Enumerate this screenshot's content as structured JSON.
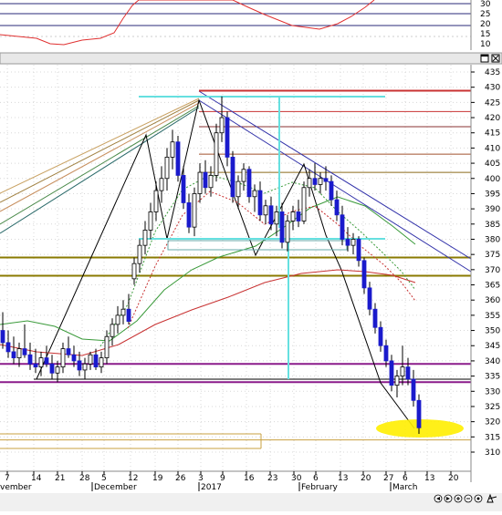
{
  "colors": {
    "bull_candle": "#ffffff",
    "bear_candle": "#1a1acc",
    "oscillator": "#e03030",
    "highlight": "#ffee00",
    "ma_red": "#c83232",
    "ma_green": "#3a9a3a",
    "trend_blue": "#3333aa",
    "cyan_marker": "#66e0e0",
    "support_purple": "#8a1b8a"
  },
  "top_panel": {
    "y_ticks": [
      "30",
      "25",
      "20",
      "15",
      "10"
    ]
  },
  "window_controls": {
    "maximize_icon": "maximize-icon",
    "close_icon": "close-icon"
  },
  "price_axis": {
    "ticks": [
      "435",
      "430",
      "425",
      "420",
      "415",
      "410",
      "405",
      "400",
      "395",
      "390",
      "385",
      "380",
      "375",
      "370",
      "365",
      "360",
      "355",
      "350",
      "345",
      "340",
      "335",
      "330",
      "325",
      "320",
      "315",
      "310"
    ]
  },
  "date_axis": {
    "day_ticks": [
      "7",
      "14",
      "21",
      "28",
      "5",
      "12",
      "19",
      "26",
      "3",
      "9",
      "16",
      "23",
      "30",
      "6",
      "13",
      "20",
      "27",
      "6",
      "13",
      "20"
    ],
    "month_labels": [
      "vember",
      "December",
      "2017",
      "February",
      "March"
    ]
  },
  "navigation": {
    "icons": [
      "scroll-left-icon",
      "scroll-right-icon",
      "zoom-in-icon",
      "zoom-out-icon",
      "reset-icon",
      "settings-icon"
    ]
  },
  "chart_data": {
    "type": "candlestick",
    "xlabel": "",
    "ylabel": "",
    "ylim": [
      307,
      437
    ],
    "candles": [
      {
        "x": 0,
        "o": 350,
        "h": 356,
        "l": 344,
        "c": 346
      },
      {
        "x": 1,
        "o": 346,
        "h": 350,
        "l": 341,
        "c": 343
      },
      {
        "x": 2,
        "o": 343,
        "h": 348,
        "l": 339,
        "c": 341
      },
      {
        "x": 3,
        "o": 341,
        "h": 346,
        "l": 338,
        "c": 344
      },
      {
        "x": 4,
        "o": 344,
        "h": 352,
        "l": 341,
        "c": 342
      },
      {
        "x": 5,
        "o": 342,
        "h": 346,
        "l": 337,
        "c": 339
      },
      {
        "x": 6,
        "o": 339,
        "h": 344,
        "l": 336,
        "c": 338
      },
      {
        "x": 7,
        "o": 338,
        "h": 343,
        "l": 335,
        "c": 341
      },
      {
        "x": 8,
        "o": 341,
        "h": 345,
        "l": 338,
        "c": 339
      },
      {
        "x": 9,
        "o": 339,
        "h": 342,
        "l": 334,
        "c": 336
      },
      {
        "x": 10,
        "o": 336,
        "h": 340,
        "l": 333,
        "c": 338
      },
      {
        "x": 11,
        "o": 338,
        "h": 346,
        "l": 336,
        "c": 344
      },
      {
        "x": 12,
        "o": 344,
        "h": 348,
        "l": 341,
        "c": 342
      },
      {
        "x": 13,
        "o": 342,
        "h": 345,
        "l": 338,
        "c": 340
      },
      {
        "x": 14,
        "o": 340,
        "h": 343,
        "l": 335,
        "c": 337
      },
      {
        "x": 15,
        "o": 337,
        "h": 341,
        "l": 334,
        "c": 339
      },
      {
        "x": 16,
        "o": 339,
        "h": 343,
        "l": 337,
        "c": 342
      },
      {
        "x": 17,
        "o": 342,
        "h": 344,
        "l": 337,
        "c": 338
      },
      {
        "x": 18,
        "o": 338,
        "h": 343,
        "l": 336,
        "c": 341
      },
      {
        "x": 19,
        "o": 341,
        "h": 350,
        "l": 339,
        "c": 348
      },
      {
        "x": 20,
        "o": 348,
        "h": 354,
        "l": 345,
        "c": 352
      },
      {
        "x": 21,
        "o": 352,
        "h": 358,
        "l": 349,
        "c": 355
      },
      {
        "x": 22,
        "o": 355,
        "h": 360,
        "l": 352,
        "c": 357
      },
      {
        "x": 23,
        "o": 357,
        "h": 362,
        "l": 352,
        "c": 353
      },
      {
        "x": 24,
        "o": 367,
        "h": 374,
        "l": 365,
        "c": 372
      },
      {
        "x": 25,
        "o": 372,
        "h": 380,
        "l": 369,
        "c": 378
      },
      {
        "x": 26,
        "o": 378,
        "h": 386,
        "l": 375,
        "c": 383
      },
      {
        "x": 27,
        "o": 383,
        "h": 392,
        "l": 380,
        "c": 389
      },
      {
        "x": 28,
        "o": 389,
        "h": 399,
        "l": 386,
        "c": 396
      },
      {
        "x": 29,
        "o": 396,
        "h": 404,
        "l": 392,
        "c": 400
      },
      {
        "x": 30,
        "o": 400,
        "h": 410,
        "l": 396,
        "c": 407
      },
      {
        "x": 31,
        "o": 407,
        "h": 416,
        "l": 403,
        "c": 412
      },
      {
        "x": 32,
        "o": 412,
        "h": 414,
        "l": 399,
        "c": 401
      },
      {
        "x": 33,
        "o": 401,
        "h": 404,
        "l": 390,
        "c": 392
      },
      {
        "x": 34,
        "o": 392,
        "h": 395,
        "l": 382,
        "c": 384
      },
      {
        "x": 35,
        "o": 384,
        "h": 397,
        "l": 381,
        "c": 395
      },
      {
        "x": 36,
        "o": 395,
        "h": 405,
        "l": 392,
        "c": 402
      },
      {
        "x": 37,
        "o": 402,
        "h": 406,
        "l": 395,
        "c": 397
      },
      {
        "x": 38,
        "o": 397,
        "h": 404,
        "l": 394,
        "c": 401
      },
      {
        "x": 39,
        "o": 401,
        "h": 418,
        "l": 399,
        "c": 415
      },
      {
        "x": 40,
        "o": 415,
        "h": 427,
        "l": 412,
        "c": 420
      },
      {
        "x": 41,
        "o": 420,
        "h": 422,
        "l": 404,
        "c": 407
      },
      {
        "x": 42,
        "o": 407,
        "h": 409,
        "l": 392,
        "c": 394
      },
      {
        "x": 43,
        "o": 394,
        "h": 401,
        "l": 390,
        "c": 399
      },
      {
        "x": 44,
        "o": 399,
        "h": 405,
        "l": 396,
        "c": 403
      },
      {
        "x": 45,
        "o": 403,
        "h": 404,
        "l": 392,
        "c": 394
      },
      {
        "x": 46,
        "o": 394,
        "h": 398,
        "l": 389,
        "c": 396
      },
      {
        "x": 47,
        "o": 396,
        "h": 399,
        "l": 386,
        "c": 388
      },
      {
        "x": 48,
        "o": 388,
        "h": 393,
        "l": 385,
        "c": 391
      },
      {
        "x": 49,
        "o": 391,
        "h": 394,
        "l": 383,
        "c": 385
      },
      {
        "x": 50,
        "o": 385,
        "h": 391,
        "l": 381,
        "c": 389
      },
      {
        "x": 51,
        "o": 389,
        "h": 392,
        "l": 377,
        "c": 379
      },
      {
        "x": 52,
        "o": 379,
        "h": 388,
        "l": 376,
        "c": 386
      },
      {
        "x": 53,
        "o": 386,
        "h": 391,
        "l": 383,
        "c": 389
      },
      {
        "x": 54,
        "o": 389,
        "h": 393,
        "l": 384,
        "c": 386
      },
      {
        "x": 55,
        "o": 386,
        "h": 399,
        "l": 385,
        "c": 397
      },
      {
        "x": 56,
        "o": 397,
        "h": 403,
        "l": 394,
        "c": 400
      },
      {
        "x": 57,
        "o": 400,
        "h": 405,
        "l": 396,
        "c": 398
      },
      {
        "x": 58,
        "o": 398,
        "h": 402,
        "l": 395,
        "c": 400
      },
      {
        "x": 59,
        "o": 400,
        "h": 404,
        "l": 396,
        "c": 399
      },
      {
        "x": 60,
        "o": 399,
        "h": 401,
        "l": 391,
        "c": 393
      },
      {
        "x": 61,
        "o": 393,
        "h": 396,
        "l": 386,
        "c": 388
      },
      {
        "x": 62,
        "o": 388,
        "h": 391,
        "l": 378,
        "c": 380
      },
      {
        "x": 63,
        "o": 380,
        "h": 384,
        "l": 376,
        "c": 378
      },
      {
        "x": 64,
        "o": 378,
        "h": 382,
        "l": 375,
        "c": 380
      },
      {
        "x": 65,
        "o": 380,
        "h": 381,
        "l": 371,
        "c": 373
      },
      {
        "x": 66,
        "o": 373,
        "h": 374,
        "l": 362,
        "c": 364
      },
      {
        "x": 67,
        "o": 364,
        "h": 366,
        "l": 355,
        "c": 357
      },
      {
        "x": 68,
        "o": 357,
        "h": 359,
        "l": 349,
        "c": 351
      },
      {
        "x": 69,
        "o": 351,
        "h": 353,
        "l": 343,
        "c": 345
      },
      {
        "x": 70,
        "o": 345,
        "h": 347,
        "l": 338,
        "c": 340
      },
      {
        "x": 71,
        "o": 340,
        "h": 342,
        "l": 330,
        "c": 332
      },
      {
        "x": 72,
        "o": 332,
        "h": 337,
        "l": 328,
        "c": 335
      },
      {
        "x": 73,
        "o": 335,
        "h": 345,
        "l": 332,
        "c": 338
      },
      {
        "x": 74,
        "o": 338,
        "h": 341,
        "l": 332,
        "c": 334
      },
      {
        "x": 75,
        "o": 334,
        "h": 337,
        "l": 325,
        "c": 327
      },
      {
        "x": 76,
        "o": 327,
        "h": 329,
        "l": 316,
        "c": 318
      }
    ],
    "horizontal_lines": [
      {
        "price": 429,
        "color": "#c83232"
      },
      {
        "price": 422,
        "color": "#c83232"
      },
      {
        "price": 417,
        "color": "#8a3030"
      },
      {
        "price": 408,
        "color": "#a0522d"
      },
      {
        "price": 402,
        "color": "#8a6a1a"
      },
      {
        "price": 374,
        "color": "#8a7a00"
      },
      {
        "price": 368,
        "color": "#8a7a00"
      },
      {
        "price": 339,
        "color": "#8a1b8a"
      },
      {
        "price": 333,
        "color": "#8a1b8a"
      },
      {
        "price": 314,
        "color": "#c8a040"
      }
    ]
  }
}
